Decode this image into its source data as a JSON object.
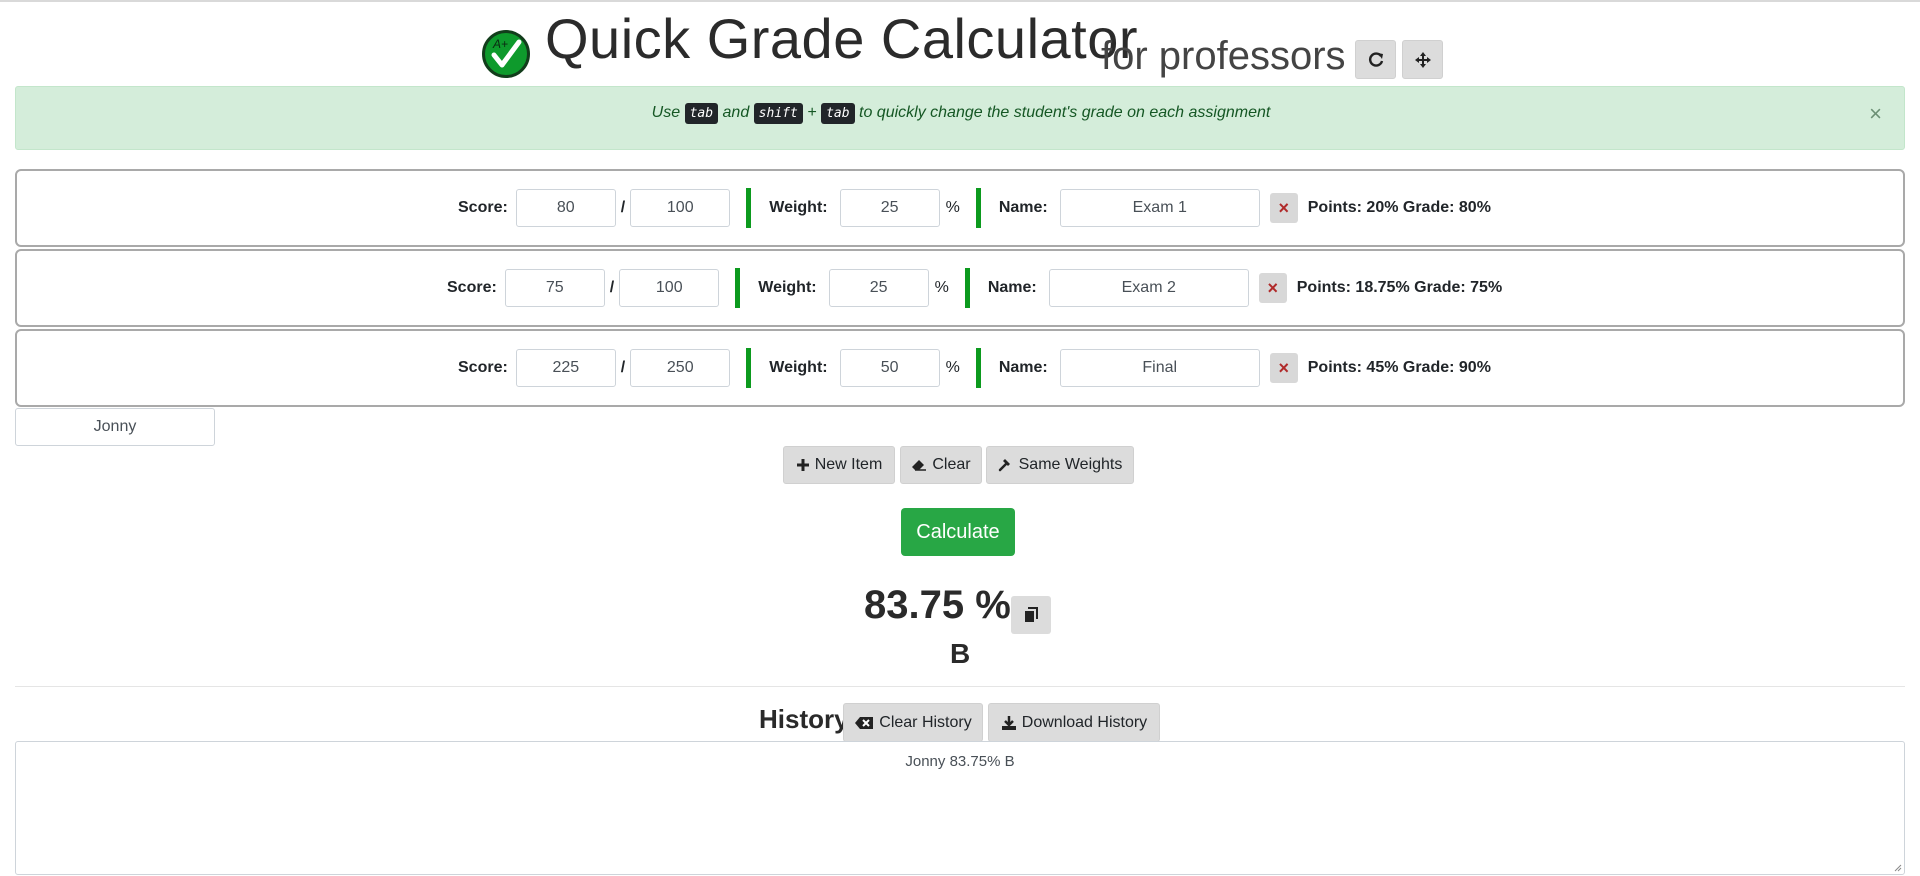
{
  "header": {
    "title": "Quick Grade Calculator",
    "subtitle": "for professors",
    "logo_text": "A+"
  },
  "alert": {
    "prefix": "Use",
    "key1": "tab",
    "and": "and",
    "key2": "shift",
    "plus": "+",
    "key3": "tab",
    "suffix": "to quickly change the student's grade on each assignment",
    "close": "×"
  },
  "labels": {
    "score": "Score:",
    "slash": "/",
    "weight": "Weight:",
    "percent": "%",
    "name": "Name:",
    "delete": "×"
  },
  "assignments": [
    {
      "score": "80",
      "total": "100",
      "weight": "25",
      "name": "Exam 1",
      "summary": "Points: 20% Grade: 80%"
    },
    {
      "score": "75",
      "total": "100",
      "weight": "25",
      "name": "Exam 2",
      "summary": "Points: 18.75% Grade: 75%"
    },
    {
      "score": "225",
      "total": "250",
      "weight": "50",
      "name": "Final",
      "summary": "Points: 45% Grade: 90%"
    }
  ],
  "student_name": "Jonny",
  "actions": {
    "new_item": "New Item",
    "clear": "Clear",
    "same_weights": "Same Weights",
    "calculate": "Calculate"
  },
  "result": {
    "percent": "83.75 %",
    "letter": "B"
  },
  "history": {
    "title": "History",
    "clear_label": "Clear History",
    "download_label": "Download History",
    "content": "Jonny 83.75% B"
  },
  "colors": {
    "accent_green": "#28a745",
    "bar_green": "#0c9a1e",
    "alert_bg": "#d4edda",
    "delete_red": "#b02a2a"
  }
}
